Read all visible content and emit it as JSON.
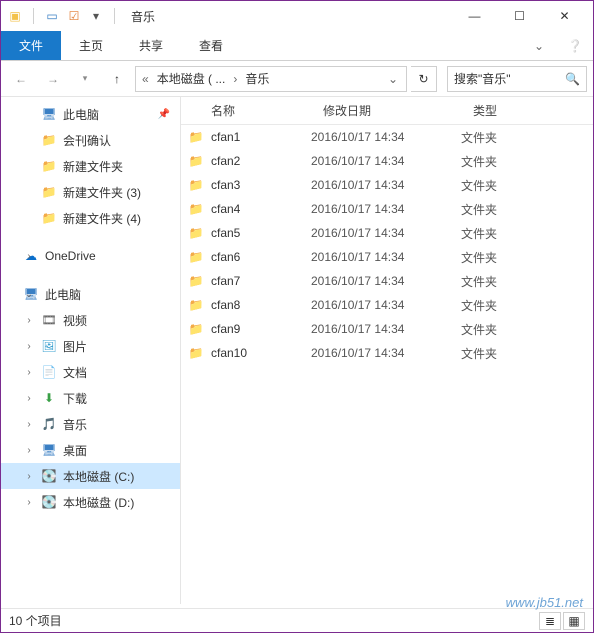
{
  "window": {
    "title": "音乐"
  },
  "ribbon": {
    "file": "文件",
    "home": "主页",
    "share": "共享",
    "view": "查看"
  },
  "address": {
    "crumb1": "本地磁盘 ( ...",
    "crumb2": "音乐"
  },
  "search": {
    "placeholder": "搜索\"音乐\""
  },
  "tree": {
    "quick_items": [
      {
        "label": "此电脑",
        "icon": "pc",
        "pinned": true
      },
      {
        "label": "会刊确认",
        "icon": "folder",
        "pinned": false
      },
      {
        "label": "新建文件夹",
        "icon": "folder",
        "pinned": false
      },
      {
        "label": "新建文件夹 (3)",
        "icon": "folder",
        "pinned": false
      },
      {
        "label": "新建文件夹 (4)",
        "icon": "folder",
        "pinned": false
      }
    ],
    "onedrive": "OneDrive",
    "this_pc": "此电脑",
    "pc_items": [
      {
        "label": "视频",
        "icon": "video"
      },
      {
        "label": "图片",
        "icon": "pictures"
      },
      {
        "label": "文档",
        "icon": "documents"
      },
      {
        "label": "下载",
        "icon": "downloads"
      },
      {
        "label": "音乐",
        "icon": "music"
      },
      {
        "label": "桌面",
        "icon": "desktop"
      },
      {
        "label": "本地磁盘 (C:)",
        "icon": "drive",
        "selected": true
      },
      {
        "label": "本地磁盘 (D:)",
        "icon": "drive",
        "selected": false
      }
    ]
  },
  "columns": {
    "name": "名称",
    "date": "修改日期",
    "type": "类型"
  },
  "rows": [
    {
      "name": "cfan1",
      "date": "2016/10/17 14:34",
      "type": "文件夹"
    },
    {
      "name": "cfan2",
      "date": "2016/10/17 14:34",
      "type": "文件夹"
    },
    {
      "name": "cfan3",
      "date": "2016/10/17 14:34",
      "type": "文件夹"
    },
    {
      "name": "cfan4",
      "date": "2016/10/17 14:34",
      "type": "文件夹"
    },
    {
      "name": "cfan5",
      "date": "2016/10/17 14:34",
      "type": "文件夹"
    },
    {
      "name": "cfan6",
      "date": "2016/10/17 14:34",
      "type": "文件夹"
    },
    {
      "name": "cfan7",
      "date": "2016/10/17 14:34",
      "type": "文件夹"
    },
    {
      "name": "cfan8",
      "date": "2016/10/17 14:34",
      "type": "文件夹"
    },
    {
      "name": "cfan9",
      "date": "2016/10/17 14:34",
      "type": "文件夹"
    },
    {
      "name": "cfan10",
      "date": "2016/10/17 14:34",
      "type": "文件夹"
    }
  ],
  "status": {
    "text": "10 个项目"
  },
  "watermark": "www.jb51.net"
}
